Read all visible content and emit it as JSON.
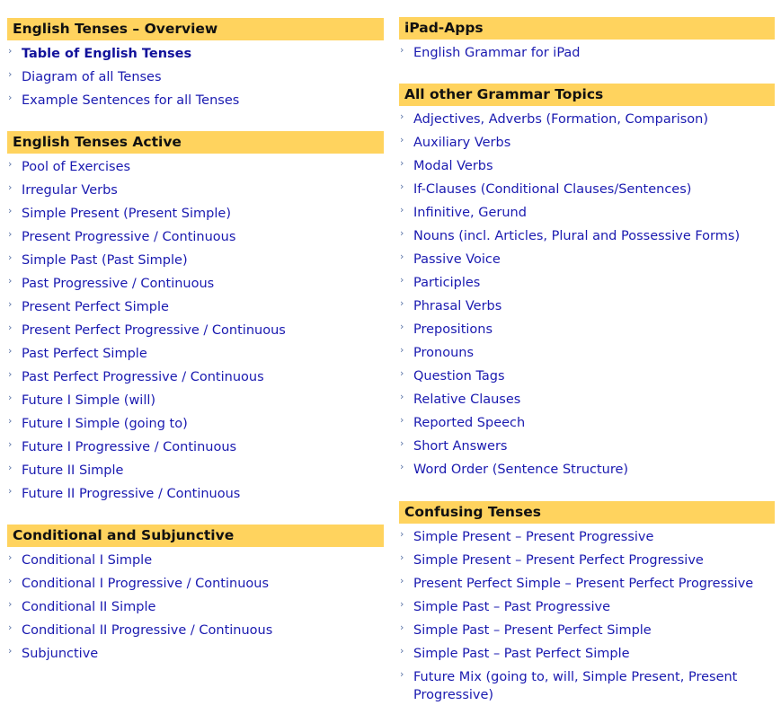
{
  "left": [
    {
      "title": "English Tenses – Overview",
      "items": [
        {
          "label": "Table of English Tenses",
          "bold": true
        },
        {
          "label": "Diagram of all Tenses"
        },
        {
          "label": "Example Sentences for all Tenses"
        }
      ]
    },
    {
      "title": "English Tenses Active",
      "items": [
        {
          "label": "Pool of Exercises"
        },
        {
          "label": "Irregular Verbs"
        },
        {
          "label": "Simple Present (Present Simple)"
        },
        {
          "label": "Present Progressive / Continuous"
        },
        {
          "label": "Simple Past (Past Simple)"
        },
        {
          "label": "Past Progressive / Continuous"
        },
        {
          "label": "Present Perfect Simple"
        },
        {
          "label": "Present Perfect Progressive / Continuous"
        },
        {
          "label": "Past Perfect Simple"
        },
        {
          "label": "Past Perfect Progressive / Continuous"
        },
        {
          "label": "Future I Simple (will)"
        },
        {
          "label": "Future I Simple (going to)"
        },
        {
          "label": "Future I Progressive / Continuous"
        },
        {
          "label": "Future II Simple"
        },
        {
          "label": "Future II Progressive / Continuous"
        }
      ]
    },
    {
      "title": "Conditional and Subjunctive",
      "items": [
        {
          "label": "Conditional I Simple"
        },
        {
          "label": "Conditional I Progressive / Continuous"
        },
        {
          "label": "Conditional II Simple"
        },
        {
          "label": "Conditional II Progressive / Continuous"
        },
        {
          "label": "Subjunctive"
        }
      ]
    }
  ],
  "right": [
    {
      "title": "iPad-Apps",
      "items": [
        {
          "label": "English Grammar for iPad"
        }
      ]
    },
    {
      "title": "All other Grammar Topics",
      "items": [
        {
          "label": "Adjectives, Adverbs (Formation, Comparison)"
        },
        {
          "label": "Auxiliary Verbs"
        },
        {
          "label": "Modal Verbs"
        },
        {
          "label": "If-Clauses (Conditional Clauses/Sentences)"
        },
        {
          "label": "Infinitive, Gerund"
        },
        {
          "label": "Nouns (incl. Articles, Plural and Possessive Forms)"
        },
        {
          "label": "Passive Voice"
        },
        {
          "label": "Participles"
        },
        {
          "label": "Phrasal Verbs"
        },
        {
          "label": "Prepositions"
        },
        {
          "label": "Pronouns"
        },
        {
          "label": "Question Tags"
        },
        {
          "label": "Relative Clauses"
        },
        {
          "label": "Reported Speech"
        },
        {
          "label": "Short Answers"
        },
        {
          "label": "Word Order (Sentence Structure)"
        }
      ]
    },
    {
      "title": "Confusing Tenses",
      "items": [
        {
          "label": "Simple Present – Present Progressive"
        },
        {
          "label": "Simple Present – Present Perfect Progressive"
        },
        {
          "label": "Present Perfect Simple – Present Perfect Progressive"
        },
        {
          "label": "Simple Past – Past Progressive"
        },
        {
          "label": "Simple Past – Present Perfect Simple"
        },
        {
          "label": "Simple Past – Past Perfect Simple"
        },
        {
          "label": "Future Mix (going to, will, Simple Present, Present Progressive)"
        }
      ]
    }
  ],
  "icons": {
    "bullet": "chevron-right-icon"
  },
  "colors": {
    "header_bg": "#ffd35e",
    "link": "#1a1ab0"
  }
}
